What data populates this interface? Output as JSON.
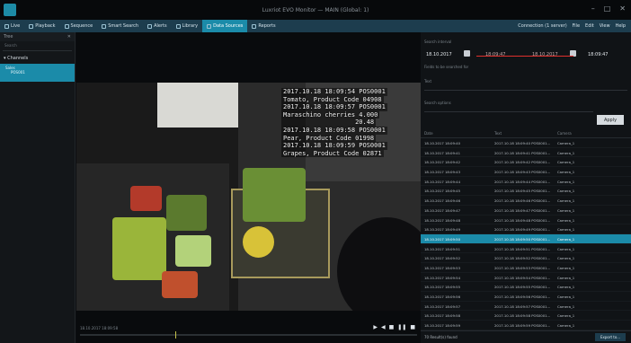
{
  "titlebar": {
    "title": "Luxriot EVO Monitor — MAIN (Global: 1)"
  },
  "menu": {
    "items": [
      {
        "label": "Live",
        "icon": "monitor-icon",
        "active": false
      },
      {
        "label": "Playback",
        "icon": "play-icon",
        "active": false
      },
      {
        "label": "Sequence",
        "icon": "sequence-icon",
        "active": false
      },
      {
        "label": "Smart Search",
        "icon": "search-icon",
        "active": false
      },
      {
        "label": "Alerts",
        "icon": "bell-icon",
        "active": false
      },
      {
        "label": "Library",
        "icon": "library-icon",
        "active": false
      },
      {
        "label": "Data Sources",
        "icon": "database-icon",
        "active": true
      },
      {
        "label": "Reports",
        "icon": "report-icon",
        "active": false
      }
    ],
    "right": [
      "Connection (1 server)",
      "File",
      "Edit",
      "View",
      "Help"
    ]
  },
  "sidebar": {
    "header": "Tree",
    "search_placeholder": "Search",
    "section": "Channels",
    "items": [
      "Sales",
      "POS001"
    ]
  },
  "overlay": {
    "lines": [
      "2017.10.18 18:09:54 POS0001",
      "Tomato, Product Code 04908",
      "2017.10.18 18:09:57 POS0001",
      "Maraschino cherries 4.000",
      "                   20.48",
      "2017.10.18 18:09:58 POS0001",
      "Pear, Product Code 01998",
      "2017.10.18 18:09:59 POS0001",
      "Grapes, Product Code 02871"
    ]
  },
  "controls": {
    "time": "18.10.2017 18:09:58",
    "buttons": [
      "▶",
      "◀",
      "■",
      "❚❚",
      "■"
    ]
  },
  "panel": {
    "label_interval": "Search interval",
    "date_from": "18.10.2017",
    "time_from": "18:09:47",
    "date_to": "18.10.2017",
    "time_to": "18:09:47",
    "label_fields": "Fields to be searched for",
    "label_text": "Text",
    "label_options": "Search options",
    "apply": "Apply",
    "columns": [
      "Date",
      "Text",
      "Camera"
    ],
    "rows": [
      [
        "18.10.2017 18:09:40",
        "2017.10.18 18:09:40 POS0001...",
        "Camera_1"
      ],
      [
        "18.10.2017 18:09:41",
        "2017.10.18 18:09:41 POS0001...",
        "Camera_1"
      ],
      [
        "18.10.2017 18:09:42",
        "2017.10.18 18:09:42 POS0001...",
        "Camera_1"
      ],
      [
        "18.10.2017 18:09:43",
        "2017.10.18 18:09:43 POS0001...",
        "Camera_1"
      ],
      [
        "18.10.2017 18:09:44",
        "2017.10.18 18:09:44 POS0001...",
        "Camera_1"
      ],
      [
        "18.10.2017 18:09:45",
        "2017.10.18 18:09:45 POS0001...",
        "Camera_1"
      ],
      [
        "18.10.2017 18:09:46",
        "2017.10.18 18:09:46 POS0001...",
        "Camera_1"
      ],
      [
        "18.10.2017 18:09:47",
        "2017.10.18 18:09:47 POS0001...",
        "Camera_1"
      ],
      [
        "18.10.2017 18:09:48",
        "2017.10.18 18:09:48 POS0001...",
        "Camera_1"
      ],
      [
        "18.10.2017 18:09:49",
        "2017.10.18 18:09:49 POS0001...",
        "Camera_1"
      ],
      [
        "18.10.2017 18:09:50",
        "2017.10.18 18:09:50 POS0001...",
        "Camera_1"
      ],
      [
        "18.10.2017 18:09:51",
        "2017.10.18 18:09:51 POS0001...",
        "Camera_1"
      ],
      [
        "18.10.2017 18:09:52",
        "2017.10.18 18:09:52 POS0001...",
        "Camera_1"
      ],
      [
        "18.10.2017 18:09:53",
        "2017.10.18 18:09:53 POS0001...",
        "Camera_1"
      ],
      [
        "18.10.2017 18:09:54",
        "2017.10.18 18:09:54 POS0001...",
        "Camera_1"
      ],
      [
        "18.10.2017 18:09:55",
        "2017.10.18 18:09:55 POS0001...",
        "Camera_1"
      ],
      [
        "18.10.2017 18:09:56",
        "2017.10.18 18:09:56 POS0001...",
        "Camera_1"
      ],
      [
        "18.10.2017 18:09:57",
        "2017.10.18 18:09:57 POS0001...",
        "Camera_1"
      ],
      [
        "18.10.2017 18:09:58",
        "2017.10.18 18:09:58 POS0001...",
        "Camera_1"
      ],
      [
        "18.10.2017 18:09:59",
        "2017.10.18 18:09:59 POS0001...",
        "Camera_1"
      ]
    ],
    "selected_row": 10,
    "found": "70 Result(s) found",
    "export": "Export to..."
  },
  "colors": {
    "accent": "#1b8ba9",
    "menubar": "#1d3d4e",
    "range_line": "#e0302d"
  }
}
